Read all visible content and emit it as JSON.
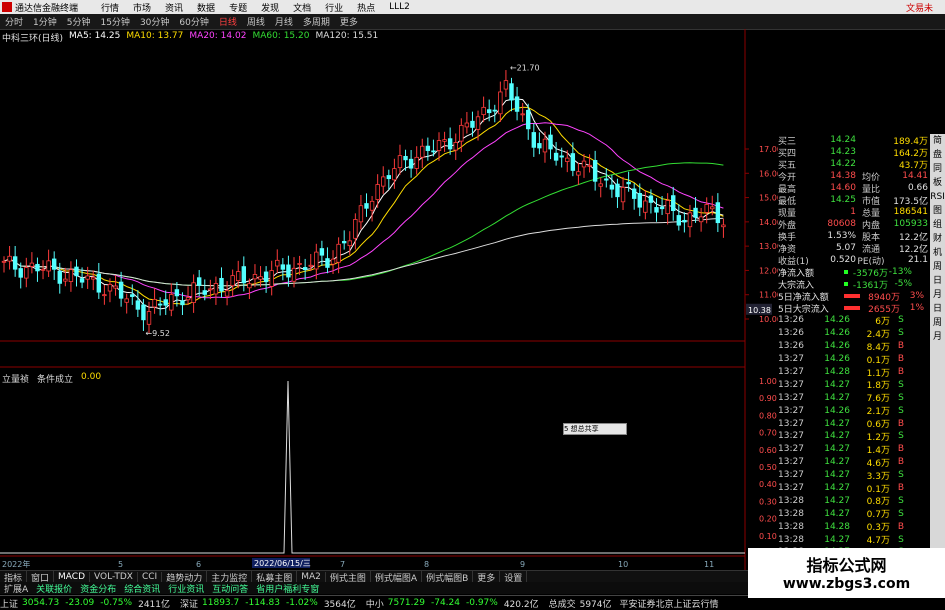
{
  "app": {
    "title": "通达信金融终端",
    "menu": [
      "行情",
      "市场",
      "资讯",
      "数据",
      "专题",
      "发现",
      "文档",
      "行业",
      "热点",
      "LLL2"
    ],
    "menu_right": "文易未"
  },
  "periods": [
    "分时",
    "1分钟",
    "5分钟",
    "15分钟",
    "30分钟",
    "60分钟",
    "日线",
    "周线",
    "月线",
    "多周期",
    "更多"
  ],
  "active_period": "日线",
  "ma_legend": {
    "stock": "中科三环(日线)",
    "items": [
      {
        "label": "MA5: 14.25",
        "color": "#ffffff"
      },
      {
        "label": "MA10: 13.77",
        "color": "#ffdd00"
      },
      {
        "label": "MA20: 14.02",
        "color": "#ff44ff"
      },
      {
        "label": "MA60: 15.20",
        "color": "#33dd33"
      },
      {
        "label": "MA120: 15.51",
        "color": "#dddddd"
      }
    ]
  },
  "price_axis": [
    "17.00",
    "16.00",
    "15.00",
    "14.00",
    "13.00",
    "12.00",
    "11.00",
    "10.00"
  ],
  "current_tag": "10.38",
  "annotations": {
    "high": "21.70",
    "low": "9.52"
  },
  "indicator": {
    "name": "立量祯",
    "condition": "条件成立",
    "value": "0.00",
    "axis": [
      "1.00",
      "0.90",
      "0.80",
      "0.70",
      "0.60",
      "0.50",
      "0.40",
      "0.30",
      "0.20",
      "0.10"
    ],
    "signal_date": "2022/06/15/三",
    "year_label": "2022年",
    "popup": "5 想总共享"
  },
  "x_ticks": [
    "5",
    "6",
    "7",
    "8",
    "9",
    "10",
    "11"
  ],
  "quote": {
    "asks_top": [
      {
        "label": "买三",
        "price": "14.24",
        "vol": "189.4万"
      },
      {
        "label": "买四",
        "price": "14.23",
        "vol": "164.2万"
      },
      {
        "label": "买五",
        "price": "14.22",
        "vol": "43.7万"
      }
    ],
    "stats": [
      {
        "l1": "今开",
        "v1": "14.38",
        "l2": "均价",
        "v2": "14.41",
        "c1": "red",
        "c2": "red"
      },
      {
        "l1": "最高",
        "v1": "14.60",
        "l2": "量比",
        "v2": "0.66",
        "c1": "red",
        "c2": "wht"
      },
      {
        "l1": "最低",
        "v1": "14.25",
        "l2": "市值",
        "v2": "173.5亿",
        "c1": "grn",
        "c2": "wht"
      },
      {
        "l1": "现量",
        "v1": "1",
        "l2": "总量",
        "v2": "186541",
        "c1": "red",
        "c2": "yel"
      },
      {
        "l1": "外盘",
        "v1": "80608",
        "l2": "内盘",
        "v2": "105933",
        "c1": "red",
        "c2": "grn"
      },
      {
        "l1": "换手",
        "v1": "1.53%",
        "l2": "股本",
        "v2": "12.2亿",
        "c1": "wht",
        "c2": "wht"
      },
      {
        "l1": "净资",
        "v1": "5.07",
        "l2": "流通",
        "v2": "12.2亿",
        "c1": "wht",
        "c2": "wht"
      },
      {
        "l1": "收益(1)",
        "v1": "0.520",
        "l2": "PE(动)",
        "v2": "21.1",
        "c1": "wht",
        "c2": "wht"
      }
    ],
    "flows": [
      {
        "label": "净流入额",
        "value": "-3576万",
        "pct": "-13%",
        "color": "grn"
      },
      {
        "label": "大宗流入",
        "value": "-1361万",
        "pct": "-5%",
        "color": "grn"
      },
      {
        "label": "5日净流入额",
        "value": "8940万",
        "pct": "3%",
        "color": "red"
      },
      {
        "label": "5日大宗流入",
        "value": "2655万",
        "pct": "1%",
        "color": "red"
      }
    ],
    "ticks": [
      {
        "t": "13:26",
        "p": "14.26",
        "v": "6万",
        "b": "S"
      },
      {
        "t": "13:26",
        "p": "14.26",
        "v": "2.4万",
        "b": "S"
      },
      {
        "t": "13:26",
        "p": "14.26",
        "v": "8.4万",
        "b": "B"
      },
      {
        "t": "13:27",
        "p": "14.26",
        "v": "0.1万",
        "b": "B"
      },
      {
        "t": "13:27",
        "p": "14.28",
        "v": "1.1万",
        "b": "B"
      },
      {
        "t": "13:27",
        "p": "14.27",
        "v": "1.8万",
        "b": "S"
      },
      {
        "t": "13:27",
        "p": "14.27",
        "v": "7.6万",
        "b": "S"
      },
      {
        "t": "13:27",
        "p": "14.26",
        "v": "2.1万",
        "b": "S"
      },
      {
        "t": "13:27",
        "p": "14.27",
        "v": "0.6万",
        "b": "B"
      },
      {
        "t": "13:27",
        "p": "14.27",
        "v": "1.2万",
        "b": "S"
      },
      {
        "t": "13:27",
        "p": "14.27",
        "v": "1.4万",
        "b": "B"
      },
      {
        "t": "13:27",
        "p": "14.27",
        "v": "4.6万",
        "b": "B"
      },
      {
        "t": "13:27",
        "p": "14.27",
        "v": "3.3万",
        "b": "S"
      },
      {
        "t": "13:27",
        "p": "14.27",
        "v": "0.1万",
        "b": "B"
      },
      {
        "t": "13:28",
        "p": "14.27",
        "v": "0.8万",
        "b": "S"
      },
      {
        "t": "13:28",
        "p": "14.27",
        "v": "0.7万",
        "b": "S"
      },
      {
        "t": "13:28",
        "p": "14.28",
        "v": "0.3万",
        "b": "B"
      },
      {
        "t": "13:28",
        "p": "14.27",
        "v": "4.7万",
        "b": "S"
      },
      {
        "t": "13:28",
        "p": "14.27",
        "v": "3.6万",
        "b": "S"
      }
    ]
  },
  "bottom_tabs": [
    "指标",
    "窗口",
    "MACD",
    "VOL-TDX",
    "CCI",
    "趋势动力",
    "主力监控",
    "私募主图",
    "MA2",
    "例式主图",
    "例式幅图A",
    "例式幅图B",
    "更多",
    "设置"
  ],
  "tabs2": [
    "扩展A",
    "关联报价",
    "资金分布",
    "综合资讯",
    "行业资讯",
    "互动问答",
    "省用户福利专窗"
  ],
  "status": {
    "sh_label": "上证",
    "sh": "3054.73",
    "sh_chg": "-23.09",
    "sh_pct": "-0.75%",
    "sh_amt": "2411亿",
    "sz_label": "深证",
    "sz": "11893.7",
    "sz_chg": "-114.83",
    "sz_pct": "-1.02%",
    "sz_amt": "3564亿",
    "zx_label": "中小",
    "zx": "7571.29",
    "zx_chg": "-74.24",
    "zx_pct": "-0.97%",
    "zx_amt": "420.2亿",
    "total_label": "总成交",
    "total": "5974亿",
    "broker": "平安证券北京上证云行情"
  },
  "side_tabs": [
    "简",
    "盘",
    "同",
    "板",
    "RSI",
    "图",
    "组",
    "财",
    "机",
    "周",
    "日",
    "月",
    "日",
    "周",
    "月"
  ],
  "watermark": {
    "line1": "指标公式网",
    "line2": "www.zbgs3.com"
  }
}
